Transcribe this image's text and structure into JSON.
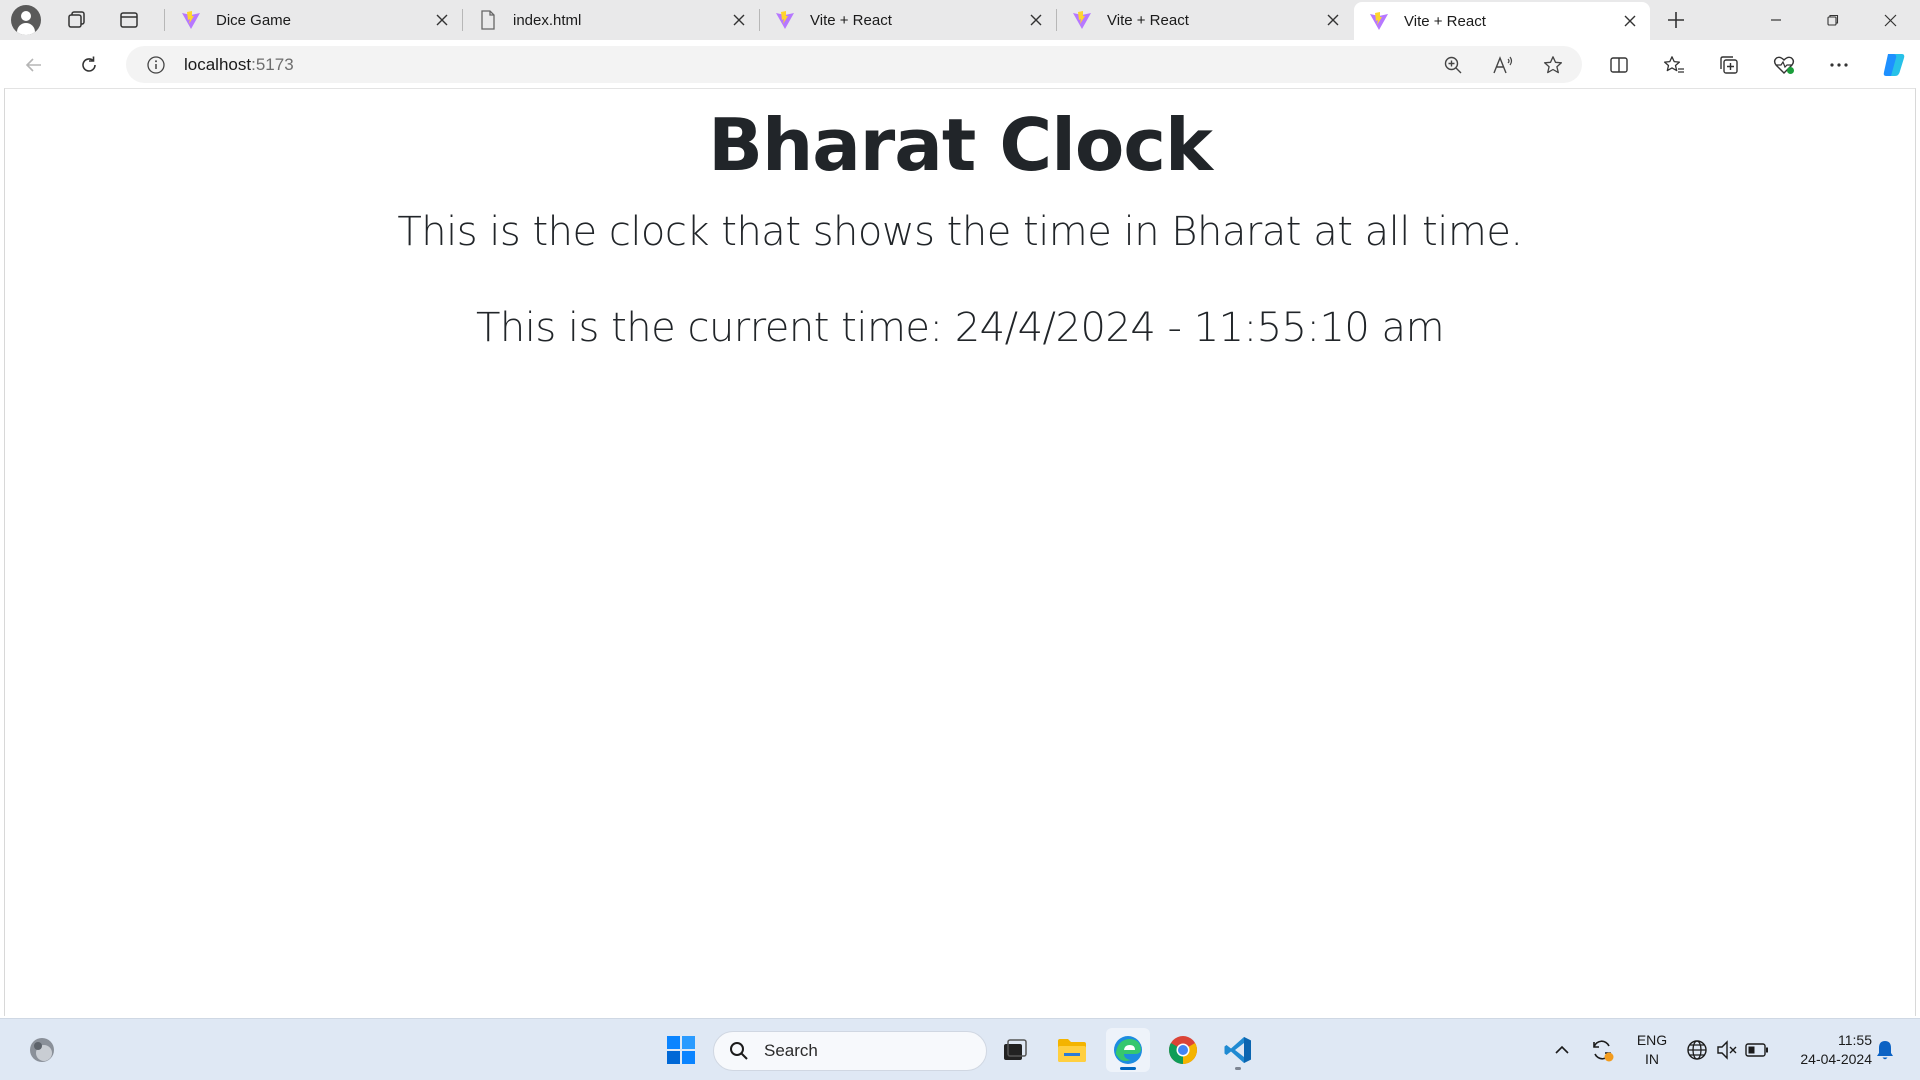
{
  "browser": {
    "tabs": [
      {
        "title": "Dice Game",
        "favicon": "vite-icon",
        "active": false
      },
      {
        "title": "index.html",
        "favicon": "file-icon",
        "active": false
      },
      {
        "title": "Vite + React",
        "favicon": "vite-icon",
        "active": false
      },
      {
        "title": "Vite + React",
        "favicon": "vite-icon",
        "active": false
      },
      {
        "title": "Vite + React",
        "favicon": "vite-icon",
        "active": true
      }
    ],
    "address": {
      "host": "localhost",
      "port": ":5173"
    }
  },
  "page": {
    "title": "Bharat Clock",
    "subtitle": "This is the clock that shows the time in Bharat at all time.",
    "current_time": "This is the current time: 24/4/2024 - 11:55:10 am"
  },
  "taskbar": {
    "search_placeholder": "Search",
    "language_line1": "ENG",
    "language_line2": "IN",
    "clock_time": "11:55",
    "clock_date": "24-04-2024"
  },
  "colors": {
    "accent": "#0067c0",
    "text": "#212529",
    "taskbar_bg": "#dfe8f4"
  }
}
